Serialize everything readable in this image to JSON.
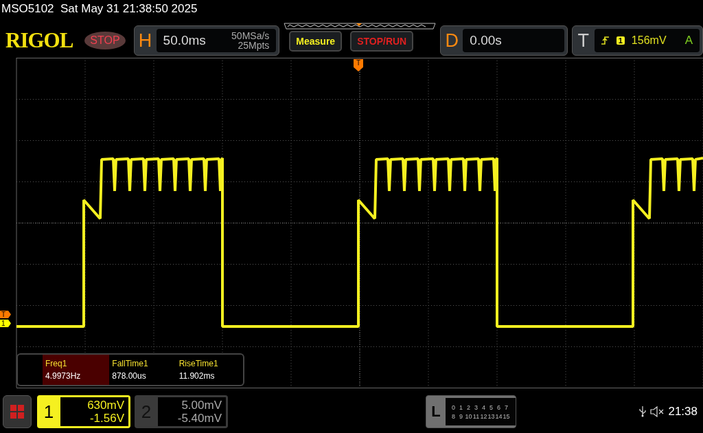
{
  "status_line": {
    "model": "MSO5102",
    "datetime": "Sat May 31 21:38:50 2025"
  },
  "header": {
    "logo": "RIGOL",
    "run_state": "STOP",
    "horizontal": {
      "label": "H",
      "timebase": "50.0ms",
      "sample_rate": "50MSa/s",
      "memory_depth": "25Mpts"
    },
    "buttons": [
      "Measure",
      "STOP/RUN"
    ],
    "delay": {
      "label": "D",
      "value": "0.00s"
    },
    "trigger": {
      "label": "T",
      "source": "1",
      "level": "156mV",
      "mode": "A"
    }
  },
  "top_marker": "T",
  "markers": [
    {
      "label": "T",
      "color": "#ff7a00"
    },
    {
      "label": "1",
      "color": "#ffff00"
    }
  ],
  "measurements": [
    {
      "name": "Freq1",
      "value": "4.9973Hz",
      "selected": true
    },
    {
      "name": "FallTime1",
      "value": "878.00us",
      "selected": false
    },
    {
      "name": "RiseTime1",
      "value": "11.902ms",
      "selected": false
    }
  ],
  "channels": [
    {
      "number": "1",
      "scale": "630mV",
      "offset": "-1.56V",
      "on": true
    },
    {
      "number": "2",
      "scale": "5.00mV",
      "offset": "-5.40mV",
      "on": false
    }
  ],
  "logic": {
    "label": "L",
    "rows": [
      [
        "0",
        "1",
        "2",
        "3",
        "4",
        "5",
        "6",
        "7"
      ],
      [
        "8",
        "9",
        "10",
        "11",
        "12",
        "13",
        "14",
        "15"
      ]
    ]
  },
  "clock": "21:38"
}
